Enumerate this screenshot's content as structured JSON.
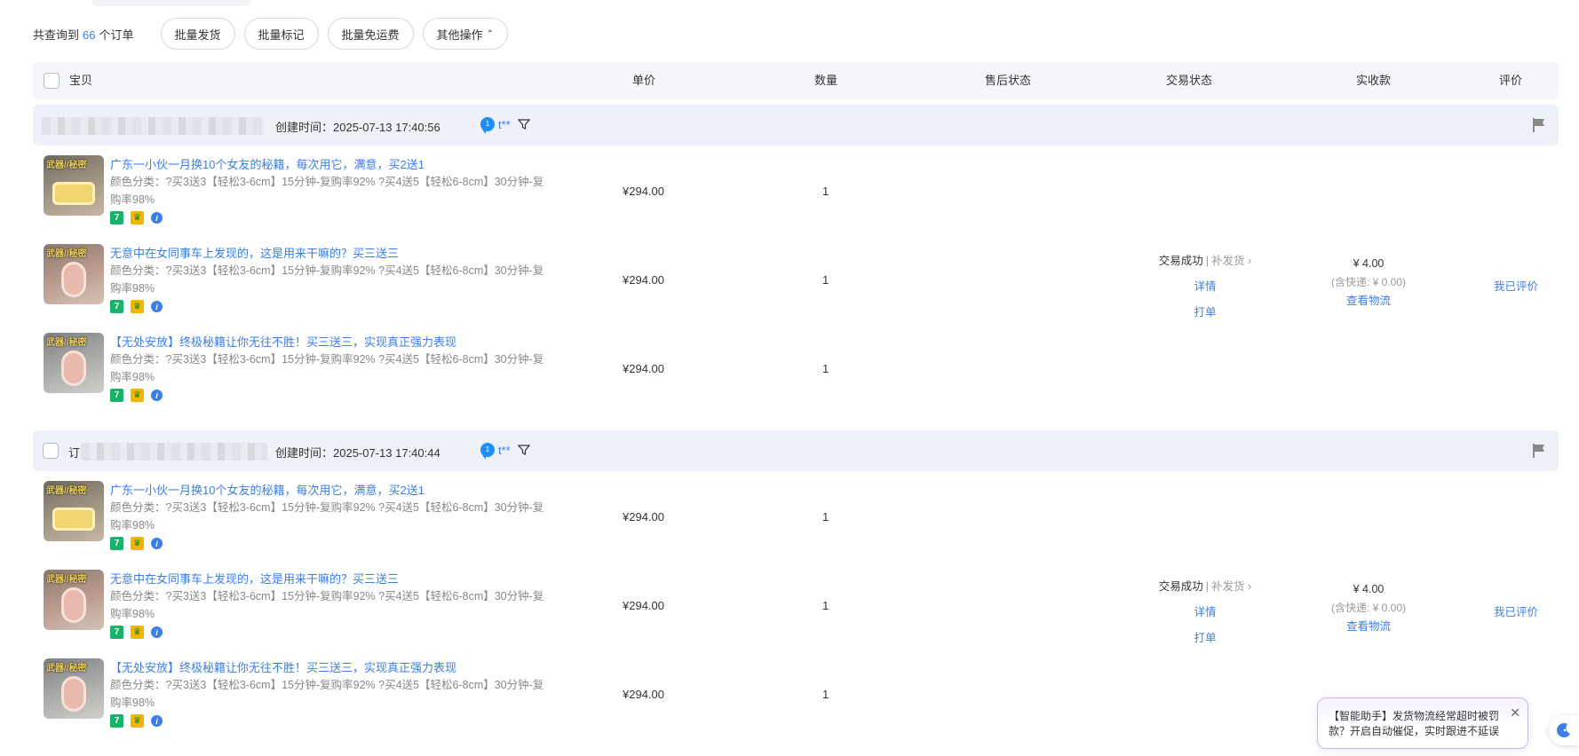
{
  "toolbar": {
    "count_prefix": "共查询到",
    "count": "66",
    "count_suffix": "个订单",
    "buttons": [
      "批量发货",
      "批量标记",
      "批量免运费",
      "其他操作"
    ]
  },
  "table_header": {
    "item": "宝贝",
    "unit_price": "单价",
    "quantity": "数量",
    "after_sale": "售后状态",
    "trade_status": "交易状态",
    "paid": "实收款",
    "review": "评价"
  },
  "orders": [
    {
      "order_prefix": "",
      "created": "创建时间：2025-07-13 17:40:56",
      "buyer": "t**",
      "chat_badge": "1",
      "status": "交易成功",
      "reship": "补发货",
      "detail": "详情",
      "print": "打单",
      "paid": "¥ 4.00",
      "shipping": "(含快递: ¥ 0.00)",
      "logistics": "查看物流",
      "review": "我已评价",
      "items": [
        {
          "thumb_label": "武器//秘密",
          "title": "广东一小伙一月换10个女友的秘籍，每次用它，满意，买2送1",
          "spec": "颜色分类：?买3送3【轻松3-6cm】15分钟-复购率92% ?买4送5【轻松6-8cm】30分钟-复购率98%",
          "price": "¥294.00",
          "qty": "1"
        },
        {
          "thumb_label": "武器//秘密",
          "title": "无意中在女同事车上发现的，这是用来干嘛的？买三送三",
          "spec": "颜色分类：?买3送3【轻松3-6cm】15分钟-复购率92% ?买4送5【轻松6-8cm】30分钟-复购率98%",
          "price": "¥294.00",
          "qty": "1"
        },
        {
          "thumb_label": "武器//秘密",
          "title": "【无处安放】终极秘籍让你无往不胜！买三送三，实现真正强力表现",
          "spec": "颜色分类：?买3送3【轻松3-6cm】15分钟-复购率92% ?买4送5【轻松6-8cm】30分钟-复购率98%",
          "price": "¥294.00",
          "qty": "1"
        }
      ]
    },
    {
      "order_prefix": "订",
      "created": "创建时间：2025-07-13 17:40:44",
      "buyer": "t**",
      "chat_badge": "1",
      "status": "交易成功",
      "reship": "补发货",
      "detail": "详情",
      "print": "打单",
      "paid": "¥ 4.00",
      "shipping": "(含快递: ¥ 0.00)",
      "logistics": "查看物流",
      "review": "我已评价",
      "items": [
        {
          "thumb_label": "武器//秘密",
          "title": "广东一小伙一月换10个女友的秘籍，每次用它，满意，买2送1",
          "spec": "颜色分类：?买3送3【轻松3-6cm】15分钟-复购率92% ?买4送5【轻松6-8cm】30分钟-复购率98%",
          "price": "¥294.00",
          "qty": "1"
        },
        {
          "thumb_label": "武器//秘密",
          "title": "无意中在女同事车上发现的，这是用来干嘛的？买三送三",
          "spec": "颜色分类：?买3送3【轻松3-6cm】15分钟-复购率92% ?买4送5【轻松6-8cm】30分钟-复购率98%",
          "price": "¥294.00",
          "qty": "1"
        },
        {
          "thumb_label": "武器//秘密",
          "title": "【无处安放】终极秘籍让你无往不胜！买三送三，实现真正强力表现",
          "spec": "颜色分类：?买3送3【轻松3-6cm】15分钟-复购率92% ?买4送5【轻松6-8cm】30分钟-复购率98%",
          "price": "¥294.00",
          "qty": "1"
        }
      ]
    }
  ],
  "assistant": {
    "message": "【智能助手】发货物流经常超时被罚款？开启自动催促，实时跟进不延误",
    "close": "✕"
  },
  "colors": {
    "link": "#3b7ee8",
    "header_bg": "#f5f6f9",
    "order_head_bg": "#eef1f7"
  }
}
